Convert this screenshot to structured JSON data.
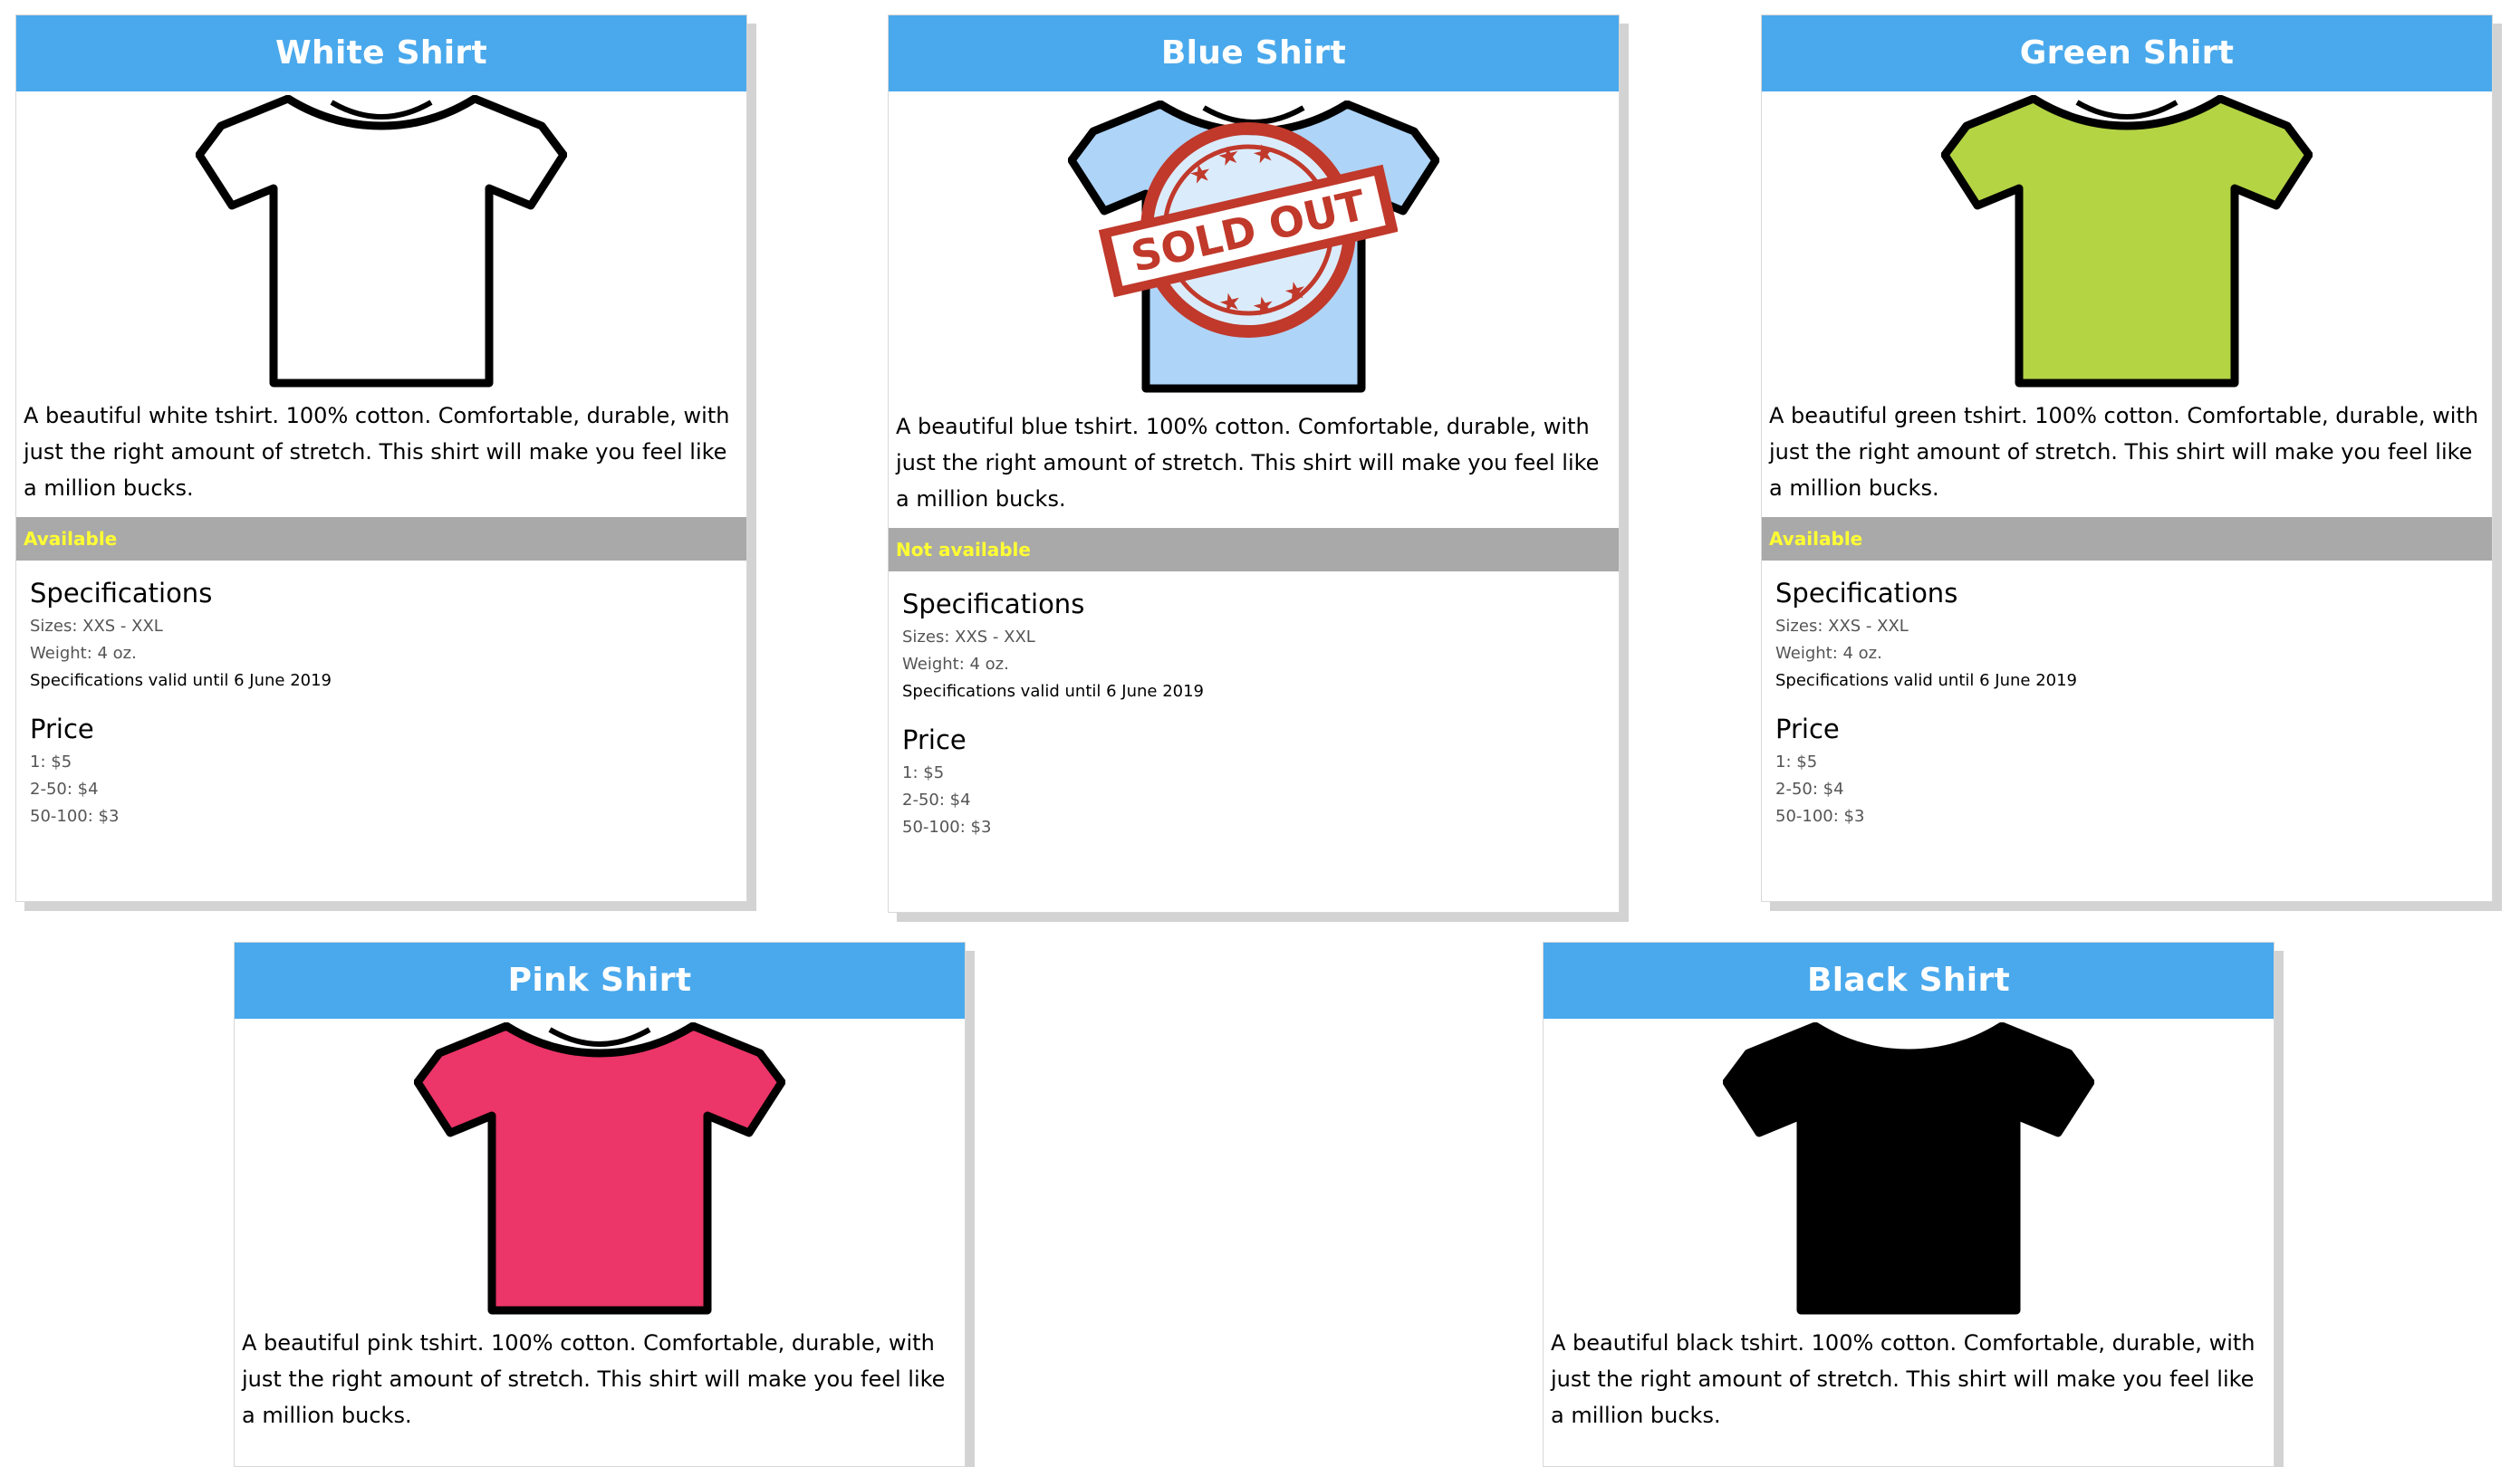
{
  "colors": {
    "header_bg": "#4aa9ec",
    "status_bg": "#a9a9a9",
    "status_text": "#ffff33",
    "stamp_red": "#c0392b"
  },
  "cards": [
    {
      "title": "White Shirt",
      "shirt_color": "#ffffff",
      "description": "A beautiful white tshirt. 100% cotton. Comfortable, durable, with just the right amount of stretch. This shirt will make you feel like a million bucks.",
      "status": "Available",
      "spec_heading": "Specifications",
      "sizes": "Sizes: XXS - XXL",
      "weight": "Weight: 4 oz.",
      "valid": "Specifications valid until 6 June 2019",
      "price_heading": "Price",
      "prices": [
        "1: $5",
        "2-50: $4",
        "50-100: $3"
      ]
    },
    {
      "title": "Blue Shirt",
      "shirt_color": "#aed4f8",
      "sold_out_stamp": "SOLD OUT",
      "description": "A beautiful blue tshirt. 100% cotton. Comfortable, durable, with just the right amount of stretch. This shirt will make you feel like a million bucks.",
      "status": "Not available",
      "spec_heading": "Specifications",
      "sizes": "Sizes: XXS - XXL",
      "weight": "Weight: 4 oz.",
      "valid": "Specifications valid until 6 June 2019",
      "price_heading": "Price",
      "prices": [
        "1: $5",
        "2-50: $4",
        "50-100: $3"
      ]
    },
    {
      "title": "Green Shirt",
      "shirt_color": "#b4d444",
      "description": "A beautiful green tshirt. 100% cotton. Comfortable, durable, with just the right amount of stretch. This shirt will make you feel like a million bucks.",
      "status": "Available",
      "spec_heading": "Specifications",
      "sizes": "Sizes: XXS - XXL",
      "weight": "Weight: 4 oz.",
      "valid": "Specifications valid until 6 June 2019",
      "price_heading": "Price",
      "prices": [
        "1: $5",
        "2-50: $4",
        "50-100: $3"
      ]
    },
    {
      "title": "Pink Shirt",
      "shirt_color": "#ec3568",
      "description": "A beautiful pink tshirt. 100% cotton. Comfortable, durable, with just the right amount of stretch. This shirt will make you feel like a million bucks."
    },
    {
      "title": "Black Shirt",
      "shirt_color": "#000000",
      "description": "A beautiful black tshirt. 100% cotton. Comfortable, durable, with just the right amount of stretch. This shirt will make you feel like a million bucks."
    }
  ]
}
